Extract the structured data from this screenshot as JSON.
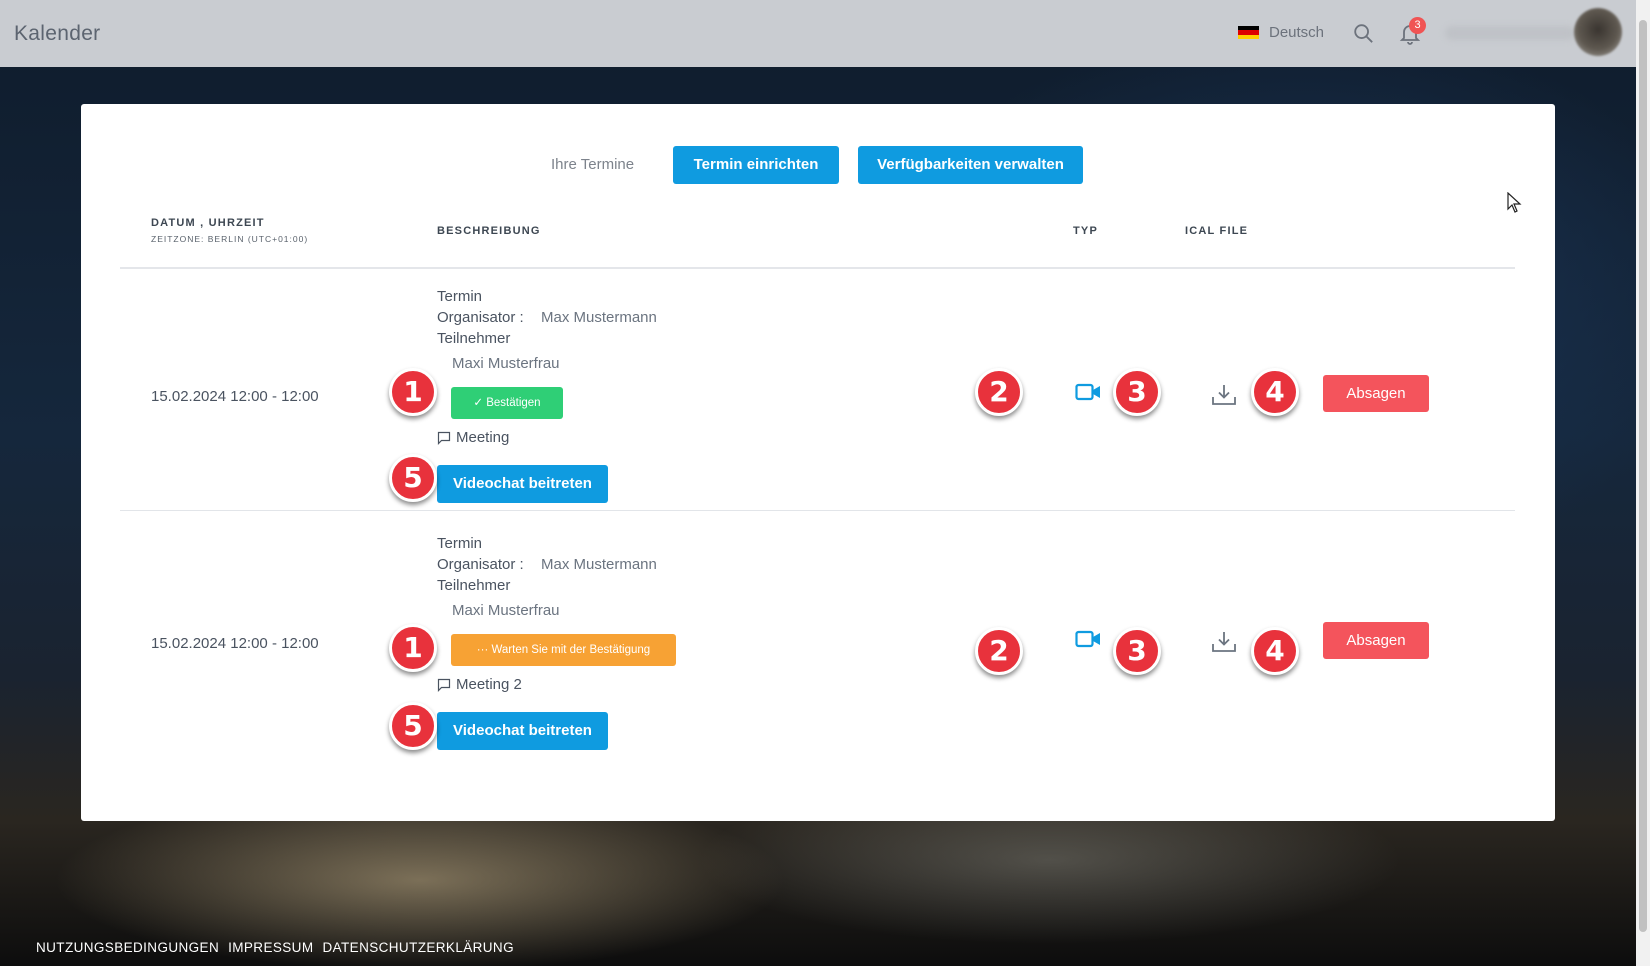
{
  "header": {
    "app_title": "Kalender",
    "language": "Deutsch",
    "notification_count": "3"
  },
  "toolbar": {
    "tab_label": "Ihre Termine",
    "setup_button": "Termin einrichten",
    "availability_button": "Verfügbarkeiten verwalten"
  },
  "table": {
    "columns": {
      "datetime": "DATUM , UHRZEIT",
      "timezone": "ZEITZONE: BERLIN (UTC+01:00)",
      "description": "BESCHREIBUNG",
      "type": "TYP",
      "ical": "ICAL FILE"
    },
    "rows": [
      {
        "datetime": "15.02.2024 12:00 - 12:00",
        "title": "Termin",
        "organizer_label": "Organisator :",
        "organizer_name": "Max Mustermann",
        "participants_label": "Teilnehmer",
        "participant_name": "Maxi Musterfrau",
        "status": "✓ Bestätigen",
        "description": "Meeting",
        "video_button": "Videochat beitreten",
        "cancel_button": "Absagen"
      },
      {
        "datetime": "15.02.2024 12:00 - 12:00",
        "title": "Termin",
        "organizer_label": "Organisator :",
        "organizer_name": "Max Mustermann",
        "participants_label": "Teilnehmer",
        "participant_name": "Maxi Musterfrau",
        "status": "··· Warten Sie mit der Bestätigung",
        "description": "Meeting 2",
        "video_button": "Videochat beitreten",
        "cancel_button": "Absagen"
      }
    ]
  },
  "markers": [
    "1",
    "2",
    "3",
    "4",
    "5"
  ],
  "footer": {
    "terms": "NUTZUNGSBEDINGUNGEN",
    "imprint": "IMPRESSUM",
    "privacy": "DATENSCHUTZERKLÄRUNG"
  },
  "colors": {
    "primary": "#0f9be0",
    "danger": "#f4545c",
    "success": "#2fcf76",
    "warning": "#f7a234",
    "marker": "#e8323c"
  },
  "icons": [
    "search-icon",
    "bell-icon",
    "video-camera-icon",
    "download-icon",
    "speech-bubble-icon",
    "flag-de-icon"
  ]
}
